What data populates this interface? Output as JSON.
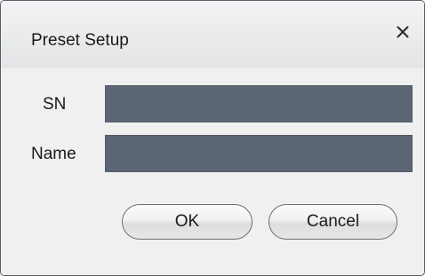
{
  "window": {
    "title": "Preset Setup",
    "close_icon": "close-icon"
  },
  "form": {
    "sn": {
      "label": "SN",
      "value": ""
    },
    "name": {
      "label": "Name",
      "value": ""
    }
  },
  "buttons": {
    "ok_label": "OK",
    "cancel_label": "Cancel"
  },
  "colors": {
    "field_background": "#5c6573",
    "dialog_background": "#f0f0f0",
    "border": "#5a5e64"
  }
}
